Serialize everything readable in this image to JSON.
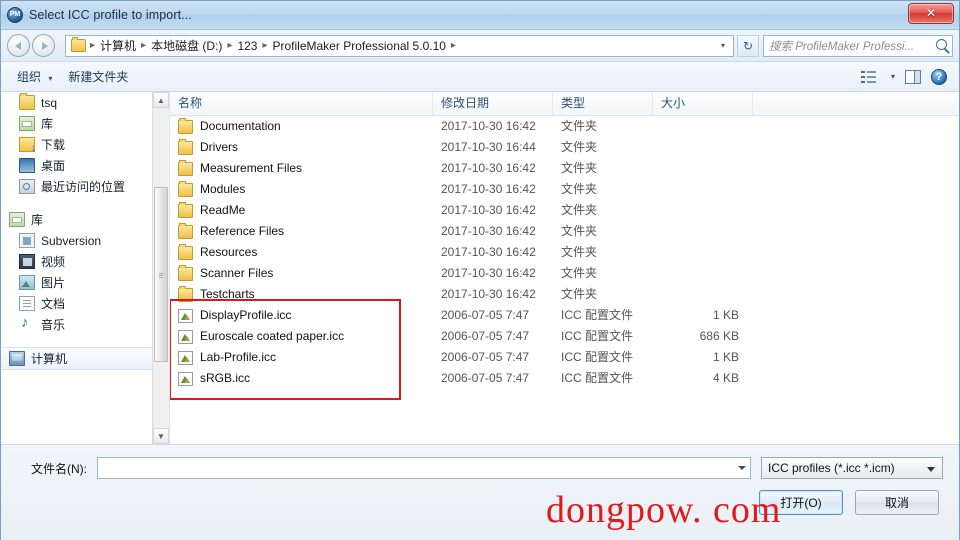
{
  "window": {
    "title": "Select ICC profile to import...",
    "icon": "profilemaker-icon",
    "close_label": "✕"
  },
  "address": {
    "back_label": "back-arrow",
    "forward_label": "forward-arrow",
    "breadcrumbs": [
      "计算机",
      "本地磁盘 (D:)",
      "123",
      "ProfileMaker Professional 5.0.10"
    ],
    "separator": "▸",
    "dropdown": "▾",
    "refresh_label": "↻",
    "search_placeholder": "搜索 ProfileMaker Professi..."
  },
  "toolbar": {
    "organize_label": "组织",
    "organize_caret": "▾",
    "new_folder_label": "新建文件夹",
    "view_caret": "▾",
    "help_label": "?"
  },
  "sidebar": {
    "items": [
      {
        "label": "tsq",
        "icon": "folder-icon",
        "indent": "child",
        "selected": false
      },
      {
        "label": "库",
        "icon": "library-icon",
        "indent": "child",
        "selected": false
      },
      {
        "label": "下载",
        "icon": "downloads-icon",
        "indent": "child",
        "selected": false
      },
      {
        "label": "桌面",
        "icon": "desktop-icon",
        "indent": "child",
        "selected": false
      },
      {
        "label": "最近访问的位置",
        "icon": "recent-places-icon",
        "indent": "child",
        "selected": false
      },
      {
        "label": "库",
        "icon": "library-icon",
        "indent": "root",
        "selected": false
      },
      {
        "label": "Subversion",
        "icon": "subversion-icon",
        "indent": "child",
        "selected": false
      },
      {
        "label": "视频",
        "icon": "videos-icon",
        "indent": "child",
        "selected": false
      },
      {
        "label": "图片",
        "icon": "pictures-icon",
        "indent": "child",
        "selected": false
      },
      {
        "label": "文档",
        "icon": "documents-icon",
        "indent": "child",
        "selected": false
      },
      {
        "label": "音乐",
        "icon": "music-icon",
        "indent": "child",
        "selected": false
      },
      {
        "label": "计算机",
        "icon": "computer-icon",
        "indent": "root",
        "selected": true
      }
    ],
    "scroll_up": "▲",
    "scroll_down": "▼"
  },
  "filelist": {
    "columns": [
      "名称",
      "修改日期",
      "类型",
      "大小"
    ],
    "rows": [
      {
        "name": "Documentation",
        "date": "2017-10-30 16:42",
        "type": "文件夹",
        "size": "",
        "icon": "folder-icon",
        "highlighted": false
      },
      {
        "name": "Drivers",
        "date": "2017-10-30 16:44",
        "type": "文件夹",
        "size": "",
        "icon": "folder-icon",
        "highlighted": false
      },
      {
        "name": "Measurement Files",
        "date": "2017-10-30 16:42",
        "type": "文件夹",
        "size": "",
        "icon": "folder-icon",
        "highlighted": false
      },
      {
        "name": "Modules",
        "date": "2017-10-30 16:42",
        "type": "文件夹",
        "size": "",
        "icon": "folder-icon",
        "highlighted": false
      },
      {
        "name": "ReadMe",
        "date": "2017-10-30 16:42",
        "type": "文件夹",
        "size": "",
        "icon": "folder-icon",
        "highlighted": false
      },
      {
        "name": "Reference Files",
        "date": "2017-10-30 16:42",
        "type": "文件夹",
        "size": "",
        "icon": "folder-icon",
        "highlighted": false
      },
      {
        "name": "Resources",
        "date": "2017-10-30 16:42",
        "type": "文件夹",
        "size": "",
        "icon": "folder-icon",
        "highlighted": false
      },
      {
        "name": "Scanner Files",
        "date": "2017-10-30 16:42",
        "type": "文件夹",
        "size": "",
        "icon": "folder-icon",
        "highlighted": false
      },
      {
        "name": "Testcharts",
        "date": "2017-10-30 16:42",
        "type": "文件夹",
        "size": "",
        "icon": "folder-icon",
        "highlighted": false
      },
      {
        "name": "DisplayProfile.icc",
        "date": "2006-07-05 7:47",
        "type": "ICC 配置文件",
        "size": "1 KB",
        "icon": "icc-profile-icon",
        "highlighted": true
      },
      {
        "name": "Euroscale coated paper.icc",
        "date": "2006-07-05 7:47",
        "type": "ICC 配置文件",
        "size": "686 KB",
        "icon": "icc-profile-icon",
        "highlighted": true
      },
      {
        "name": "Lab-Profile.icc",
        "date": "2006-07-05 7:47",
        "type": "ICC 配置文件",
        "size": "1 KB",
        "icon": "icc-profile-icon",
        "highlighted": true
      },
      {
        "name": "sRGB.icc",
        "date": "2006-07-05 7:47",
        "type": "ICC 配置文件",
        "size": "4 KB",
        "icon": "icc-profile-icon",
        "highlighted": true
      }
    ]
  },
  "bottom": {
    "filename_label": "文件名(N):",
    "filename_value": "",
    "filetype_value": "ICC profiles (*.icc *.icm)",
    "open_label": "打开(O)",
    "cancel_label": "取消"
  },
  "overlay": {
    "watermark": "dongpow. com",
    "highlight_color": "#d71920",
    "watermark_color": "#e01b1b"
  }
}
